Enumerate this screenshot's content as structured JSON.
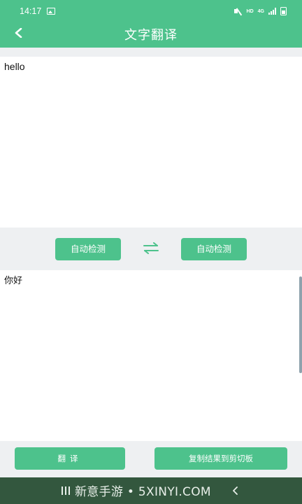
{
  "status_bar": {
    "time": "14:17",
    "hd_badge": "HD",
    "network_badge": "4G"
  },
  "header": {
    "title": "文字翻译",
    "back_icon": "chevron-left-icon"
  },
  "source": {
    "text": "hello"
  },
  "languages": {
    "from_label": "自动检测",
    "to_label": "自动检测",
    "swap_icon": "swap-arrows-icon"
  },
  "target": {
    "text": "你好"
  },
  "actions": {
    "translate_label": "翻译",
    "copy_label": "复制结果到剪切板"
  },
  "watermark": {
    "text": "新意手游 • 5XINYI.COM"
  },
  "colors": {
    "accent": "#4dc28c",
    "background": "#eef0f2",
    "watermark_bg": "#33573e"
  }
}
